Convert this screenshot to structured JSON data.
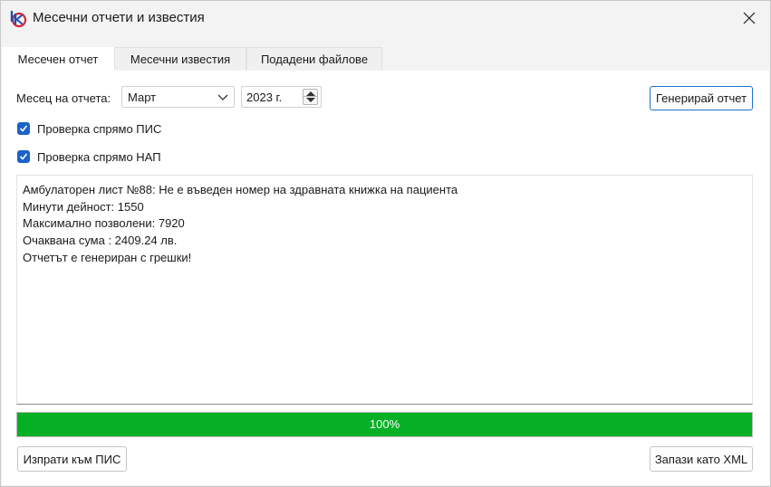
{
  "window": {
    "title": "Месечни отчети и известия",
    "icon": "app-logo-icon"
  },
  "tabs": [
    {
      "label": "Месечен отчет",
      "active": true
    },
    {
      "label": "Месечни известия",
      "active": false
    },
    {
      "label": "Подадени файлове",
      "active": false
    }
  ],
  "form": {
    "month_label": "Месец на отчета:",
    "month_value": "Март",
    "year_value": "2023 г.",
    "generate_label": "Генерирай отчет",
    "check_pis_label": "Проверка спрямо ПИС",
    "check_pis_checked": true,
    "check_nap_label": "Проверка спрямо НАП",
    "check_nap_checked": true
  },
  "log": {
    "lines": [
      "Амбулаторен лист №88: Не е въведен номер на здравната книжка на пациента",
      "Минути дейност: 1550",
      "Максимално позволени: 7920",
      "Очаквана сума : 2409.24 лв.",
      "Отчетът е генериран с грешки!"
    ]
  },
  "progress": {
    "value": 1.0,
    "label": "100%",
    "color": "#06b025"
  },
  "footer": {
    "send_label": "Изпрати към ПИС",
    "save_label": "Запази като XML"
  },
  "colors": {
    "accent": "#1b63c8",
    "window_bg": "#f3f3f3"
  }
}
